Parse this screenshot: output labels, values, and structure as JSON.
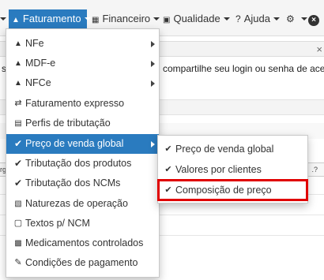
{
  "background": {
    "close_icon": "×",
    "notice_start": "s.",
    "notice_rest": "compartilhe seu login ou senha de acesso",
    "header_left": "rg",
    "header_right": ".?"
  },
  "nav": {
    "faturamento": "Faturamento",
    "financeiro": "Financeiro",
    "qualidade": "Qualidade",
    "ajuda": "Ajuda",
    "accent": "#2a7bbf"
  },
  "menu": {
    "items": [
      {
        "label": "NFe",
        "icon": "bank-icon",
        "submenu": true
      },
      {
        "label": "MDF-e",
        "icon": "bank-icon",
        "submenu": true
      },
      {
        "label": "NFCe",
        "icon": "bank-icon",
        "submenu": true
      },
      {
        "label": "Faturamento expresso",
        "icon": "exchange-icon",
        "submenu": false
      },
      {
        "label": "Perfis de tributação",
        "icon": "hdd-icon",
        "submenu": false
      },
      {
        "label": "Preço de venda global",
        "icon": "check-icon",
        "submenu": true,
        "highlighted": true
      },
      {
        "label": "Tributação dos produtos",
        "icon": "check-icon",
        "submenu": false
      },
      {
        "label": "Tributação dos NCMs",
        "icon": "check-icon",
        "submenu": false
      },
      {
        "label": "Naturezas de operação",
        "icon": "book-icon",
        "submenu": false
      },
      {
        "label": "Textos p/ NCM",
        "icon": "file-icon",
        "submenu": false
      },
      {
        "label": "Medicamentos controlados",
        "icon": "medkit-icon",
        "submenu": false
      },
      {
        "label": "Condições de pagamento",
        "icon": "pencil-icon",
        "submenu": false
      }
    ]
  },
  "submenu": {
    "items": [
      {
        "label": "Preço de venda global",
        "icon": "check-icon"
      },
      {
        "label": "Valores por clientes",
        "icon": "check-icon"
      },
      {
        "label": "Composição de preço",
        "icon": "check-icon",
        "highlight_box": true
      }
    ],
    "highlight_color": "#e00000"
  }
}
